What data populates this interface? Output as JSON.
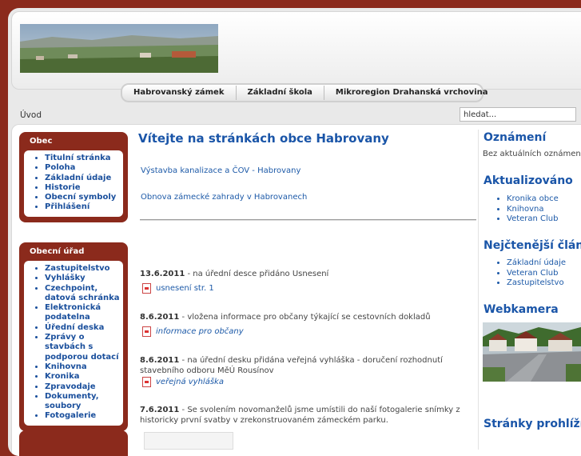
{
  "nav": {
    "items": [
      "Habrovanský zámek",
      "Základní škola",
      "Mikroregion Drahanská vrchovina"
    ]
  },
  "breadcrumb": "Úvod",
  "search": {
    "value": "hledat..."
  },
  "sidebar": {
    "obec": {
      "title": "Obec",
      "items": [
        "Titulní stránka",
        "Poloha",
        "Základní údaje",
        "Historie",
        "Obecní symboly",
        "Přihlášení"
      ]
    },
    "urad": {
      "title": "Obecní úřad",
      "items": [
        "Zastupitelstvo",
        "Vyhlášky",
        "Czechpoint, datová schránka",
        "Elektronická podatelna",
        "Úřední deska",
        "Zprávy o stavbách s podporou dotací",
        "Knihovna",
        "Kronika",
        "Zpravodaje",
        "Dokumenty, soubory",
        "Fotogalerie"
      ]
    }
  },
  "main": {
    "title": "Vítejte na stránkách obce Habrovany",
    "links": [
      "Výstavba kanalizace a ČOV - Habrovany",
      "Obnova zámecké zahrady v Habrovanech"
    ],
    "news": [
      {
        "date": "13.6.2011",
        "text": " - na úřední desce přidáno Usnesení",
        "attachment": "usnesení str. 1"
      },
      {
        "date": "8.6.2011",
        "text": " - vložena informace pro občany týkající se cestovních dokladů",
        "attachment": "informace pro občany"
      },
      {
        "date": "8.6.2011",
        "text": " - na úřední desku přidána veřejná vyhláška - doručení rozhodnutí stavebního odboru MěÚ Rousínov",
        "attachment": "veřejná vyhláška"
      },
      {
        "date": "7.6.2011",
        "text": " - Se svolením novomanželů jsme umístili do naší fotogalerie snímky z historicky první svatby v zrekonstruovaném zámeckém parku."
      }
    ]
  },
  "right": {
    "oznameni_title": "Oznámení",
    "oznameni_text": "Bez aktuálních oznámení",
    "aktualizovano_title": "Aktualizováno",
    "aktualizovano_items": [
      "Kronika obce",
      "Knihovna",
      "Veteran Club"
    ],
    "nejctenejsi_title": "Nejčtenější články",
    "nejctenejsi_items": [
      "Základní údaje",
      "Veteran Club",
      "Zastupitelstvo"
    ],
    "webkamera_title": "Webkamera",
    "stranky_title": "Stránky prohlíží"
  },
  "colors": {
    "accent": "#8b2a1c",
    "link": "#1a55a8"
  }
}
